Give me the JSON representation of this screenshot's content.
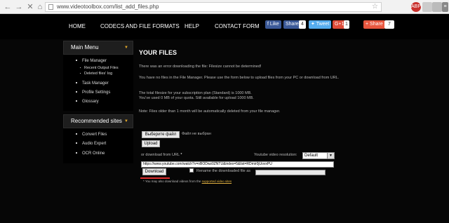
{
  "browser": {
    "url": "www.videotoolbox.com/list_add_files.php",
    "back_icon": "arrow-left-icon",
    "forward_icon": "arrow-right-icon",
    "close_icon": "close-icon",
    "home_icon": "home-icon",
    "ext1": "ABP",
    "ext2": "",
    "ext3": "",
    "ext4": "S"
  },
  "nav": {
    "items": [
      "Home",
      "Codecs and File Formats",
      "Help",
      "Contact Form"
    ]
  },
  "social": {
    "fb_label": "Like",
    "fb_share": "Share",
    "fb_count": "4",
    "tweet": "Tweet",
    "gplus": "G+1",
    "gplus_count": "1",
    "share": "Share",
    "share_count": "7",
    "colors": {
      "facebook": "#3b5998",
      "twitter": "#55acee",
      "gplus": "#dd4b39",
      "share": "#e8573f"
    }
  },
  "sidebar": {
    "main_menu": {
      "title": "Main Menu",
      "items": [
        {
          "label": "File Manager",
          "sub": [
            "Recent Output Files",
            "Deleted files' log"
          ]
        },
        {
          "label": "Task Manager",
          "sub": []
        },
        {
          "label": "Profile Settings",
          "sub": []
        },
        {
          "label": "Glossary",
          "sub": []
        }
      ]
    },
    "recommended": {
      "title": "Recommended sites",
      "items": [
        "Convert Files",
        "Audio Expert",
        "OCR Online"
      ]
    }
  },
  "main": {
    "title": "Your Files",
    "error": "There was an error downloading the file: Filesize cannot be determined!",
    "no_files": "You have no files in the File Manager. Please use the form below to upload files from your PC or download from URL.",
    "filesize_line1": "The total filesize for your subscription plan (Standard) is 1000 MB.",
    "filesize_line2": "You've used 0 MB of your quota. Still available for upload 1000 MB.",
    "note": "Note: Files older than 1 month will be automatically deleted from your file manager.",
    "choose_file_btn": "Выберите файл",
    "no_file_chosen": "Файл не выбран",
    "upload_btn": "Upload",
    "or_download_label": "or download from URL",
    "asterisk": "*",
    "resolution_label": "Youtube video resolution:",
    "resolution_value": "Default",
    "url_value": "https://www.youtube.com/watch?v=nBODwz0ZNTU&index=5&list=RDmir0jUovxPU",
    "download_btn": "Download",
    "rename_label": "Rename the downloaded file as",
    "footnote_prefix": "You may also download videos from the",
    "footnote_link": "supported video sites",
    "accent": "#e03030"
  }
}
